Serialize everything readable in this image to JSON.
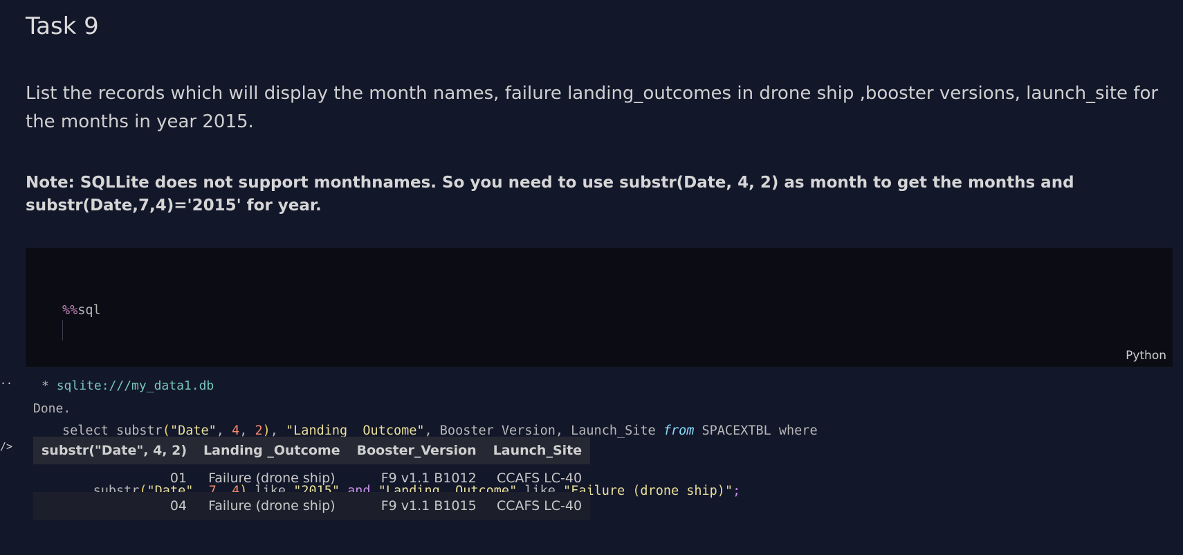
{
  "heading": "Task 9",
  "description": "List the records which will display the month names, failure landing_outcomes in drone ship ,booster versions, launch_site for the months in year 2015.",
  "note": "Note: SQLLite does not support monthnames. So you need to use substr(Date, 4, 2) as month to get the months and substr(Date,7,4)='2015' for year.",
  "code_cell": {
    "language": "Python",
    "magic": "%%",
    "magic_name": "sql",
    "line2": {
      "select": "select",
      "fn": "substr",
      "arg1": "\"Date\"",
      "n1": "4",
      "n2": "2",
      "col": "\"Landing _Outcome\"",
      "rest1": "Booster_Version, Launch_Site",
      "from": "from",
      "rest2": "SPACEXTBL where"
    },
    "line3": {
      "fn": "substr",
      "arg1": "\"Date\"",
      "n1": "7",
      "n2": "4",
      "like1": "like",
      "year": "\"2015\"",
      "and": "and",
      "col": "\"Landing _Outcome\"",
      "like2": "like",
      "value": "\"Failure (drone ship)\"",
      "end": ";"
    }
  },
  "output": {
    "gutter_more": "··",
    "gutter_code": "/>",
    "connection_prefix": "* ",
    "connection": "sqlite:///my_data1.db",
    "status": "Done.",
    "table": {
      "headers": [
        "substr(\"Date\", 4, 2)",
        "Landing _Outcome",
        "Booster_Version",
        "Launch_Site"
      ],
      "rows": [
        [
          "01",
          "Failure (drone ship)",
          "F9 v1.1 B1012",
          "CCAFS LC-40"
        ],
        [
          "04",
          "Failure (drone ship)",
          "F9 v1.1 B1015",
          "CCAFS LC-40"
        ]
      ]
    }
  }
}
